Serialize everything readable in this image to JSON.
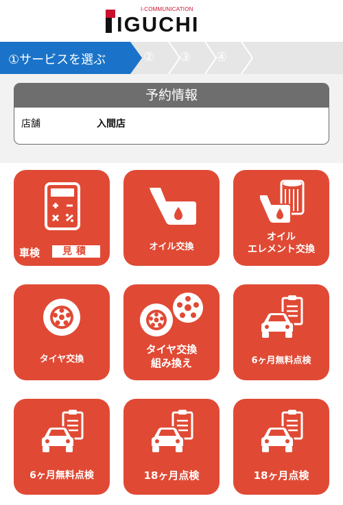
{
  "brand": {
    "tagline": "I-COMMUNICATION",
    "name": "IGUCHI",
    "colors": {
      "accent": "#c8102e",
      "tile": "#e04a35",
      "step_active": "#1a73c8",
      "step_inactive": "#e6e6e6"
    }
  },
  "steps": [
    {
      "label": "①サービスを選ぶ",
      "active": true
    },
    {
      "label": "②",
      "active": false
    },
    {
      "label": "③",
      "active": false
    },
    {
      "label": "④",
      "active": false
    }
  ],
  "reservation": {
    "title": "予約情報",
    "store_label": "店舗",
    "store_value": "入間店"
  },
  "services": [
    {
      "label_main": "車検",
      "label_box": "見積",
      "icon": "calculator-icon"
    },
    {
      "label": "オイル交換",
      "icon": "oil-can-icon"
    },
    {
      "label_line1": "オイル",
      "label_line2": "エレメント交換",
      "icon": "oil-filter-icon"
    },
    {
      "label": "タイヤ交換",
      "icon": "tire-icon"
    },
    {
      "label_line1": "タイヤ交換",
      "label_line2": "組み換え",
      "icon": "tire-wheel-icon"
    },
    {
      "label": "6ヶ月無料点検",
      "icon": "car-checklist-icon"
    },
    {
      "label": "6ヶ月無料点検",
      "icon": "car-checklist-icon"
    },
    {
      "label": "18ヶ月点検",
      "icon": "car-checklist-icon"
    },
    {
      "label": "18ヶ月点検",
      "icon": "car-checklist-icon"
    }
  ]
}
